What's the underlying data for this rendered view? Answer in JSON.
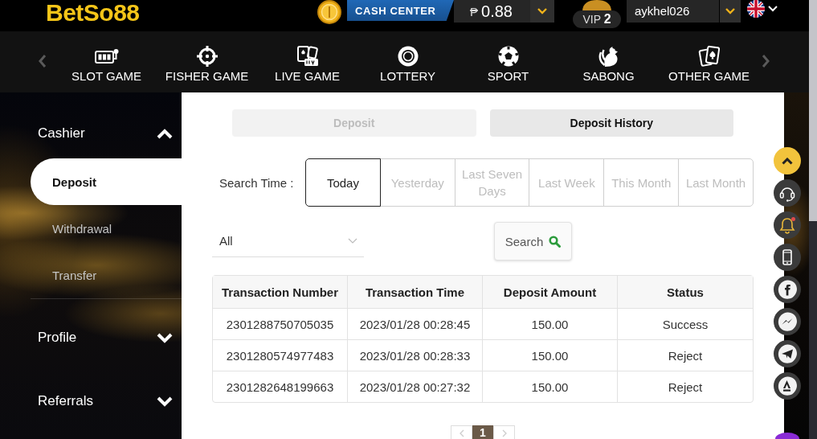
{
  "header": {
    "logo": "BetSo88",
    "cash_center": {
      "label": "CASH CENTER",
      "currency": "₱",
      "balance": "0.88"
    },
    "user": {
      "vip": "VIP **2**",
      "username": "aykhel026"
    }
  },
  "game_nav": {
    "items": [
      {
        "label": "SLOT GAME"
      },
      {
        "label": "FISHER GAME"
      },
      {
        "label": "LIVE GAME"
      },
      {
        "label": "LOTTERY"
      },
      {
        "label": "SPORT"
      },
      {
        "label": "SABONG"
      },
      {
        "label": "OTHER GAME"
      }
    ]
  },
  "sidebar": {
    "groups": [
      {
        "label": "Cashier",
        "expanded": true,
        "children": [
          {
            "label": "Deposit",
            "selected": true
          },
          {
            "label": "Withdrawal",
            "selected": false
          },
          {
            "label": "Transfer",
            "selected": false
          }
        ]
      },
      {
        "label": "Profile",
        "expanded": false
      },
      {
        "label": "Referrals",
        "expanded": false
      }
    ]
  },
  "tabs": [
    {
      "label": "Deposit",
      "selected": false
    },
    {
      "label": "Deposit History",
      "selected": true
    }
  ],
  "search_time": {
    "label": "Search Time :",
    "options": [
      {
        "label": "Today",
        "selected": true
      },
      {
        "label": "Yesterday",
        "selected": false
      },
      {
        "label": "Last Seven Days",
        "selected": false
      },
      {
        "label": "Last Week",
        "selected": false
      },
      {
        "label": "This Month",
        "selected": false
      },
      {
        "label": "Last Month",
        "selected": false
      }
    ]
  },
  "filter": {
    "value": "All"
  },
  "search_button": {
    "label": "Search"
  },
  "table": {
    "columns": [
      "Transaction Number",
      "Transaction Time",
      "Deposit Amount",
      "Status"
    ],
    "rows": [
      [
        "2301288750705035",
        "2023/01/28 00:28:45",
        "150.00",
        "Success"
      ],
      [
        "2301280574977483",
        "2023/01/28 00:28:33",
        "150.00",
        "Reject"
      ],
      [
        "2301282648199663",
        "2023/01/28 00:27:32",
        "150.00",
        "Reject"
      ]
    ]
  },
  "pagination": {
    "pages": [
      {
        "label": "1",
        "selected": true
      }
    ]
  }
}
